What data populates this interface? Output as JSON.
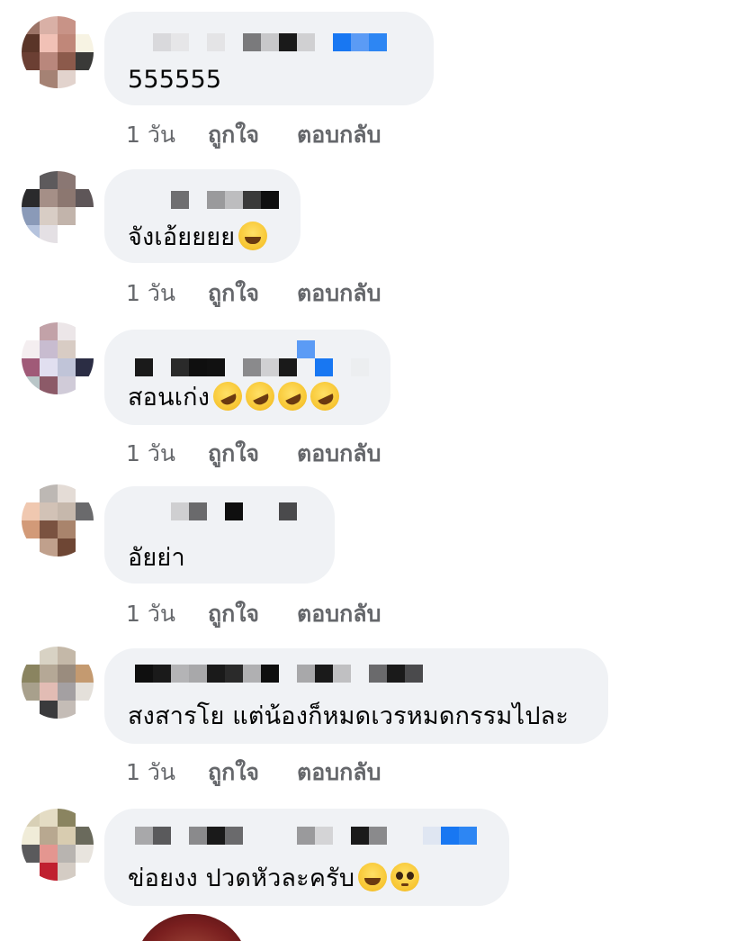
{
  "comments": [
    {
      "text": "555555",
      "emojis": [],
      "time": "1 วัน",
      "like_label": "ถูกใจ",
      "reply_label": "ตอบกลับ"
    },
    {
      "text": "จังเอ้ยยยย",
      "emojis": [
        "grinning-sweat-emoji"
      ],
      "time": "1 วัน",
      "like_label": "ถูกใจ",
      "reply_label": "ตอบกลับ"
    },
    {
      "text": "สอนเก่ง",
      "emojis": [
        "rofl-emoji",
        "rofl-emoji",
        "rofl-emoji",
        "rofl-emoji"
      ],
      "time": "1 วัน",
      "like_label": "ถูกใจ",
      "reply_label": "ตอบกลับ"
    },
    {
      "text": "อัยย่า",
      "emojis": [],
      "time": "1 วัน",
      "like_label": "ถูกใจ",
      "reply_label": "ตอบกลับ"
    },
    {
      "text": "สงสารโย แต่น้องก็หมดเวรหมดกรรมไปละ",
      "emojis": [],
      "time": "1 วัน",
      "like_label": "ถูกใจ",
      "reply_label": "ตอบกลับ"
    },
    {
      "text": "ข่อยงง ปวดหัวละครับ",
      "emojis": [
        "joy-emoji",
        "pleading-emoji"
      ],
      "time": "",
      "like_label": "",
      "reply_label": ""
    }
  ],
  "colors": {
    "bubble": "#f0f2f5",
    "meta_text": "#65676b",
    "link_blue": "#1877f2"
  }
}
